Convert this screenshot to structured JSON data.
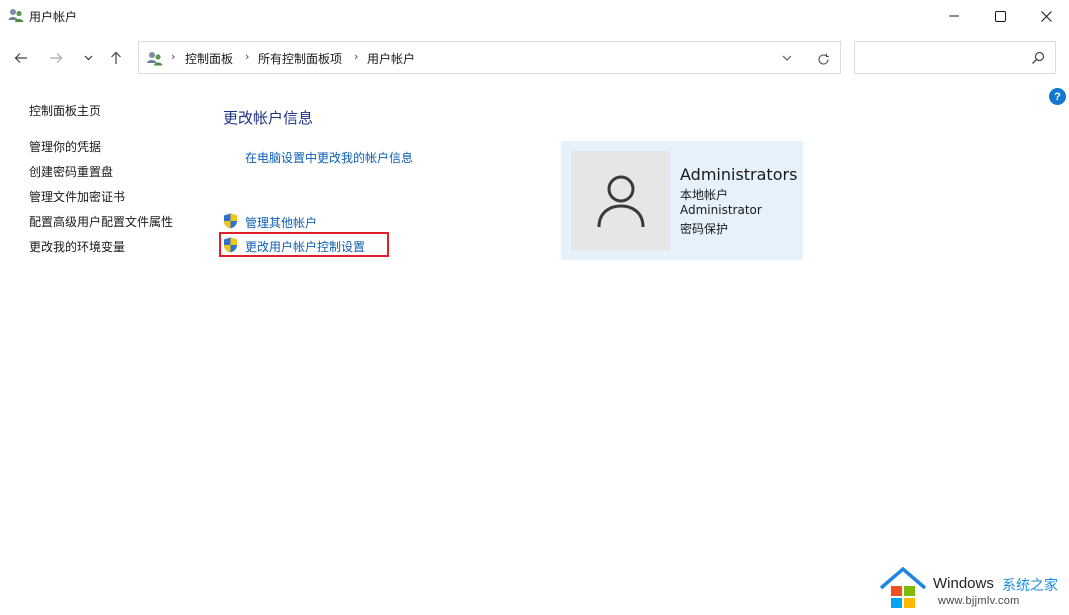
{
  "window": {
    "title": "用户帐户",
    "controls": {
      "minimize": "minimize-icon",
      "maximize": "maximize-icon",
      "close": "close-icon"
    }
  },
  "navigation": {
    "back_icon": "arrow-left-icon",
    "forward_icon": "arrow-right-icon",
    "recent_icon": "chevron-down-icon",
    "up_icon": "arrow-up-icon"
  },
  "address": {
    "icon": "user-accounts-icon",
    "breadcrumbs": [
      "控制面板",
      "所有控制面板项",
      "用户帐户"
    ]
  },
  "search": {
    "placeholder": "",
    "icon": "search-icon"
  },
  "help": {
    "label": "?"
  },
  "sidebar": {
    "home": "控制面板主页",
    "items": [
      "管理你的凭据",
      "创建密码重置盘",
      "管理文件加密证书",
      "配置高级用户配置文件属性",
      "更改我的环境变量"
    ]
  },
  "main": {
    "heading": "更改帐户信息",
    "pc_settings_link": "在电脑设置中更改我的帐户信息",
    "manage_other_link": "管理其他帐户",
    "uac_link": "更改用户帐户控制设置",
    "highlight_color": "#e2202a"
  },
  "user": {
    "name": "Administrators",
    "type": "本地帐户",
    "account": "Administrator",
    "protection": "密码保护"
  },
  "watermark": {
    "brand": "Windows",
    "site_name": "系统之家",
    "url": "www.bjjmlv.com"
  },
  "colors": {
    "link": "#0d5fb3",
    "heading": "#1e3287",
    "card_bg": "#e5f1fb",
    "accent": "#1677d2"
  }
}
